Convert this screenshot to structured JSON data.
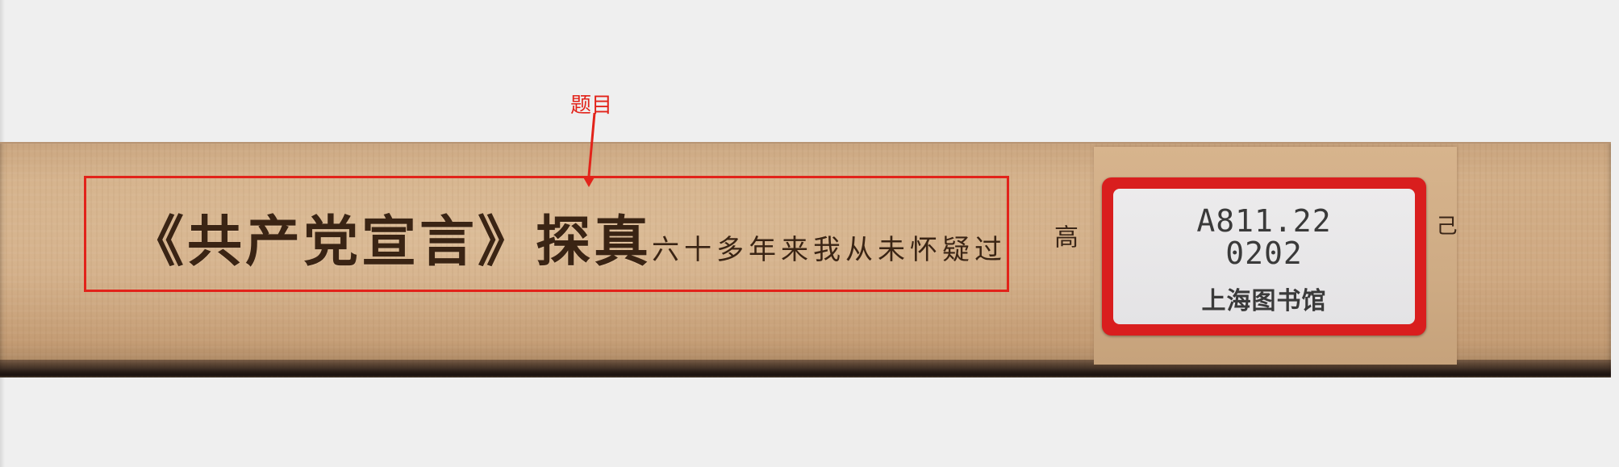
{
  "annotation": {
    "label": "题目",
    "color": "#e2231a"
  },
  "book_spine": {
    "title": "《共产党宣言》探真",
    "author_line": "六十多年来我从未怀疑过",
    "top_mark": "高",
    "side_mark": "己",
    "call_number": {
      "line1": "A811.22",
      "line2": "0202",
      "library": "上海图书馆"
    },
    "label_color": "#d91e1e"
  }
}
